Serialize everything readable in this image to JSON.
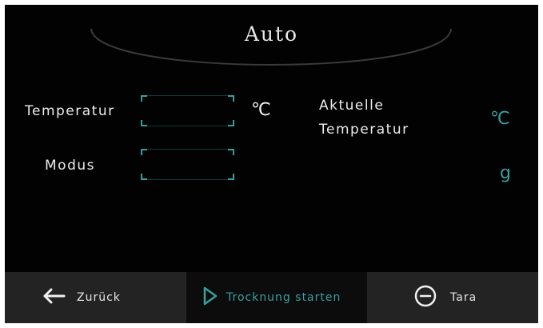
{
  "header": {
    "title": "Auto"
  },
  "form": {
    "temperature_label": "Temperatur",
    "temperature_unit": "℃",
    "temperature_value": "",
    "mode_label": "Modus",
    "mode_value": ""
  },
  "readout": {
    "current_temp_label_line1": "Aktuelle",
    "current_temp_label_line2": "Temperatur",
    "current_temp_unit": "℃",
    "weight_unit": "g"
  },
  "footer": {
    "back_label": "Zurück",
    "start_label": "Trocknung starten",
    "tare_label": "Tara"
  },
  "colors": {
    "accent": "#3a9e9e",
    "background": "#020202",
    "bar": "#232323"
  },
  "icons": {
    "back": "arrow-left-icon",
    "start": "play-icon",
    "tare": "minus-circle-icon"
  }
}
